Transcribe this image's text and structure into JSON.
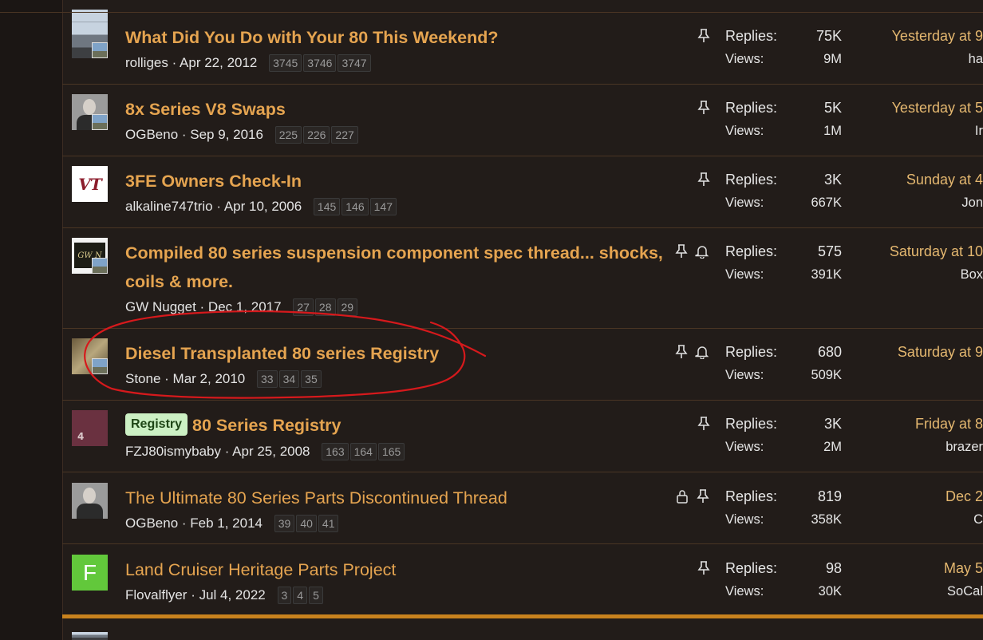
{
  "labels": {
    "replies": "Replies:",
    "views": "Views:"
  },
  "colors": {
    "title": "#e5a450",
    "accent_bar": "#c8821e",
    "prefix_bg": "#ccf0c4",
    "annotation": "#d6191c"
  },
  "threads": [
    {
      "title": "What Did You Do with Your 80 This Weekend?",
      "author": "rolliges",
      "date": "Apr 22, 2012",
      "pages": [
        "3745",
        "3746",
        "3747"
      ],
      "icons": [
        "pin-icon"
      ],
      "replies": "75K",
      "views": "9M",
      "last_time": "Yesterday at 9",
      "last_user": "ha"
    },
    {
      "title": "8x Series V8 Swaps",
      "author": "OGBeno",
      "date": "Sep 9, 2016",
      "pages": [
        "225",
        "226",
        "227"
      ],
      "icons": [
        "pin-icon"
      ],
      "replies": "5K",
      "views": "1M",
      "last_time": "Yesterday at 5",
      "last_user": "Ir"
    },
    {
      "title": "3FE Owners Check-In",
      "author": "alkaline747trio",
      "date": "Apr 10, 2006",
      "pages": [
        "145",
        "146",
        "147"
      ],
      "icons": [
        "pin-icon"
      ],
      "replies": "3K",
      "views": "667K",
      "last_time": "Sunday at 4",
      "last_user": "Jon"
    },
    {
      "title": "Compiled 80 series suspension component spec thread... shocks, coils & more.",
      "author": "GW Nugget",
      "date": "Dec 1, 2017",
      "pages": [
        "27",
        "28",
        "29"
      ],
      "icons": [
        "pin-icon",
        "bell-icon"
      ],
      "replies": "575",
      "views": "391K",
      "last_time": "Saturday at 10",
      "last_user": "Box"
    },
    {
      "title": "Diesel Transplanted 80 series Registry",
      "author": "Stone",
      "date": "Mar 2, 2010",
      "pages": [
        "33",
        "34",
        "35"
      ],
      "icons": [
        "pin-icon",
        "bell-icon"
      ],
      "replies": "680",
      "views": "509K",
      "last_time": "Saturday at 9",
      "last_user": ""
    },
    {
      "prefix": "Registry",
      "title": "80 Series Registry",
      "author": "FZJ80ismybaby",
      "date": "Apr 25, 2008",
      "pages": [
        "163",
        "164",
        "165"
      ],
      "icons": [
        "pin-icon"
      ],
      "replies": "3K",
      "views": "2M",
      "last_time": "Friday at 8",
      "last_user": "brazer"
    },
    {
      "title": "The Ultimate 80 Series Parts Discontinued Thread",
      "author": "OGBeno",
      "date": "Feb 1, 2014",
      "pages": [
        "39",
        "40",
        "41"
      ],
      "icons": [
        "lock-icon",
        "pin-icon"
      ],
      "replies": "819",
      "views": "358K",
      "last_time": "Dec 2",
      "last_user": "C"
    },
    {
      "avatar_letter": "F",
      "title": "Land Cruiser Heritage Parts Project",
      "author": "Flovalflyer",
      "date": "Jul 4, 2022",
      "pages": [
        "3",
        "4",
        "5"
      ],
      "icons": [
        "pin-icon"
      ],
      "replies": "98",
      "views": "30K",
      "last_time": "May 5",
      "last_user": "SoCal"
    }
  ],
  "avatars": {
    "vt_text": "VT",
    "plate_text": "GW N",
    "bull_text": "4"
  }
}
